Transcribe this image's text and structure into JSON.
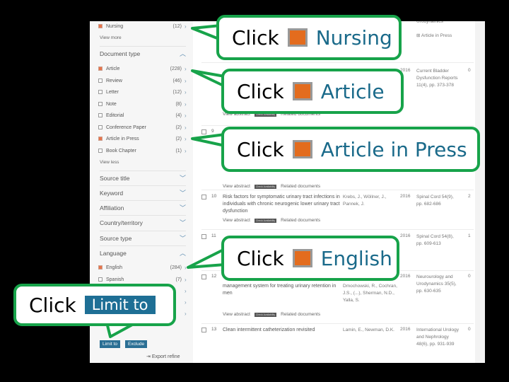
{
  "sidebar": {
    "top_item": {
      "label": "Nursing",
      "count": "(12)",
      "checked": true
    },
    "view_more": "View more",
    "document_type": {
      "title": "Document type",
      "items": [
        {
          "label": "Article",
          "count": "(228)",
          "checked": true
        },
        {
          "label": "Review",
          "count": "(46)",
          "checked": false
        },
        {
          "label": "Letter",
          "count": "(12)",
          "checked": false
        },
        {
          "label": "Note",
          "count": "(8)",
          "checked": false
        },
        {
          "label": "Editorial",
          "count": "(4)",
          "checked": false
        },
        {
          "label": "Conference Paper",
          "count": "(2)",
          "checked": false
        },
        {
          "label": "Article in Press",
          "count": "(2)",
          "checked": true
        },
        {
          "label": "Book Chapter",
          "count": "(1)",
          "checked": false
        }
      ],
      "view_less": "View less"
    },
    "collapsed_sections": [
      "Source title",
      "Keyword",
      "Affiliation",
      "Country/territory",
      "Source type"
    ],
    "language": {
      "title": "Language",
      "items": [
        {
          "label": "English",
          "count": "(284)",
          "checked": true
        },
        {
          "label": "Spanish",
          "count": "(7)",
          "checked": false
        }
      ]
    },
    "limit_to_label": "Limit to",
    "exclude_label": "Exclude",
    "export_refine_label": "Export refine"
  },
  "results": {
    "partial_top": {
      "source": "Urodynamics",
      "aip_label": "Article in Press"
    },
    "row8": {
      "year": "2016",
      "source": "Current Bladder Dysfunction Reports 11(4), pp. 373-378",
      "cited": "0"
    },
    "actions": {
      "view_abstract": "View abstract",
      "check_availability": "Check Availability",
      "related": "Related documents"
    },
    "rows": [
      {
        "num": "9",
        "title": "",
        "authors": "",
        "year": "",
        "source": "",
        "cited": ""
      },
      {
        "num": "10",
        "title": "Risk factors for symptomatic urinary tract infections in individuals with chronic neurogenic lower urinary tract dysfunction",
        "authors": "Krebs, J., Wöllner, J., Pannek, J.",
        "year": "2016",
        "source": "Spinal Cord 54(9), pp. 682-686",
        "cited": "2"
      },
      {
        "num": "11",
        "title": "",
        "authors": "",
        "year": "2016",
        "source": "Spinal Cord 54(8), pp. 609-613",
        "cited": "1"
      },
      {
        "num": "12",
        "title": "management system for treating urinary retention in men",
        "authors": "Dmochowski, R., Cochran, J.S., (...), Sherman, N.D., Yalla, S.",
        "year": "2016",
        "source": "Neurourology and Urodynamics 35(5), pp. 630-635",
        "cited": "0"
      },
      {
        "num": "13",
        "title": "Clean intermittent catheterization revisited",
        "authors": "Lamin, E., Newman, D.K.",
        "year": "2016",
        "source": "International Urology and Nephrology 48(6), pp. 931-939",
        "cited": "0"
      }
    ]
  },
  "callouts": {
    "click_word": "Click",
    "nursing": "Nursing",
    "article": "Article",
    "article_in_press": "Article in Press",
    "english": "English",
    "limit_to": "Limit to"
  },
  "colors": {
    "callout_border": "#17a34a",
    "checkbox_accent": "#e36c1e",
    "link_blue": "#1a6a8a",
    "button_blue": "#1e6f95"
  }
}
